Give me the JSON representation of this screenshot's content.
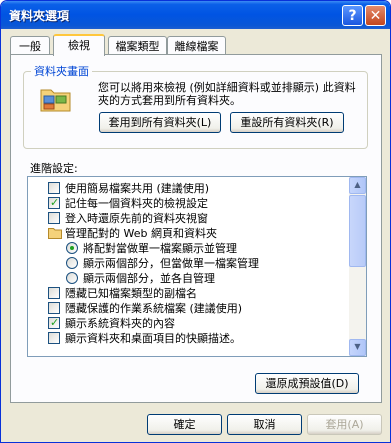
{
  "window": {
    "title": "資料夾選項",
    "help_glyph": "?",
    "close_glyph": "✕"
  },
  "tabs": [
    {
      "label": "一般",
      "active": false
    },
    {
      "label": "檢視",
      "active": true
    },
    {
      "label": "檔案類型",
      "active": false
    },
    {
      "label": "離線檔案",
      "active": false
    }
  ],
  "folder_views": {
    "title": "資料夾畫面",
    "description": "您可以將用來檢視 (例如詳細資料或並排顯示) 此資料夾的方式套用到所有資料夾。",
    "apply_all_label": "套用到所有資料夾(L)",
    "reset_all_label": "重設所有資料夾(R)"
  },
  "advanced": {
    "label": "進階設定:",
    "items": [
      {
        "type": "checkbox",
        "checked": false,
        "indent": 0,
        "label": "使用簡易檔案共用 (建議使用)"
      },
      {
        "type": "checkbox",
        "checked": true,
        "indent": 0,
        "label": "記住每一個資料夾的檢視設定"
      },
      {
        "type": "checkbox",
        "checked": false,
        "indent": 0,
        "label": "登入時還原先前的資料夾視窗"
      },
      {
        "type": "folder",
        "indent": 0,
        "label": "管理配對的 Web 網頁和資料夾"
      },
      {
        "type": "radio",
        "checked": true,
        "indent": 1,
        "label": "將配對當做單一檔案顯示並管理"
      },
      {
        "type": "radio",
        "checked": false,
        "indent": 1,
        "label": "顯示兩個部分，但當做單一檔案管理"
      },
      {
        "type": "radio",
        "checked": false,
        "indent": 1,
        "label": "顯示兩個部分，並各自管理"
      },
      {
        "type": "checkbox",
        "checked": false,
        "indent": 0,
        "label": "隱藏已知檔案類型的副檔名"
      },
      {
        "type": "checkbox",
        "checked": false,
        "indent": 0,
        "label": "隱藏保護的作業系統檔案 (建議使用)"
      },
      {
        "type": "checkbox",
        "checked": true,
        "indent": 0,
        "label": "顯示系統資料夾的內容"
      },
      {
        "type": "checkbox",
        "checked": false,
        "indent": 0,
        "label": "顯示資料夾和桌面項目的快顯描述。"
      }
    ]
  },
  "restore_defaults_label": "還原成預設值(D)",
  "footer": {
    "ok_label": "確定",
    "cancel_label": "取消",
    "apply_label": "套用(A)"
  }
}
